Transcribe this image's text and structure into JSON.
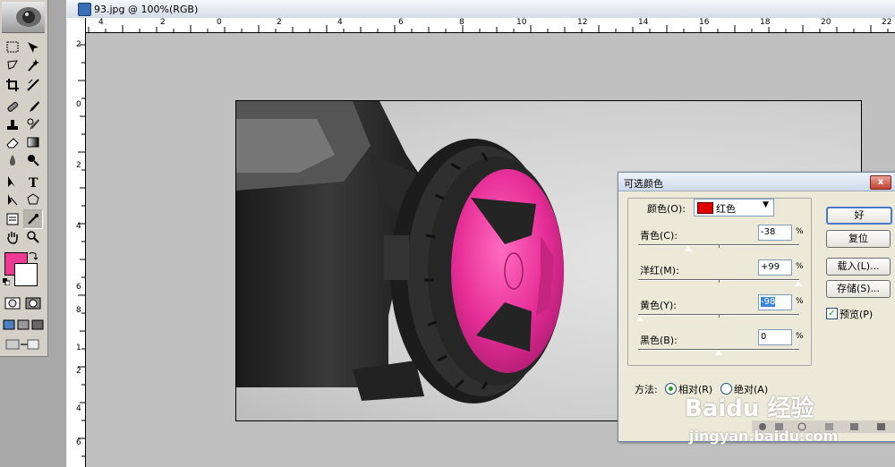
{
  "document": {
    "title": "93.jpg @ 100%(RGB)",
    "h_ruler": [
      "4",
      "2",
      "0",
      "2",
      "4",
      "6",
      "8",
      "10",
      "12",
      "14",
      "16",
      "18",
      "20",
      "22"
    ],
    "v_ruler": [
      "2",
      "0",
      "2",
      "4",
      "6",
      "8",
      "1",
      "2",
      "4",
      "6"
    ]
  },
  "toolbox": {
    "foreground_color": "#ee3a92",
    "background_color": "#ffffff"
  },
  "dialog": {
    "title": "可选颜色",
    "close_label": "x",
    "colors_label": "颜色(O):",
    "colors_value": "红色",
    "sliders": [
      {
        "label": "青色(C):",
        "value": "-38",
        "unit": "%",
        "level": -38
      },
      {
        "label": "洋红(M):",
        "value": "+99",
        "unit": "%",
        "level": 99
      },
      {
        "label": "黄色(Y):",
        "value": "-98",
        "unit": "%",
        "level": -98
      },
      {
        "label": "黑色(B):",
        "value": "0",
        "unit": "%",
        "level": 0
      }
    ],
    "method_label": "方法:",
    "method_options": [
      "相对(R)",
      "绝对(A)"
    ],
    "buttons": {
      "ok": "好",
      "reset": "复位",
      "load": "载入(L)...",
      "save": "存储(S)..."
    },
    "preview_label": "预览(P)"
  },
  "watermark": {
    "brand": "Baidu 经验",
    "url": "jingyan.baidu.com"
  }
}
